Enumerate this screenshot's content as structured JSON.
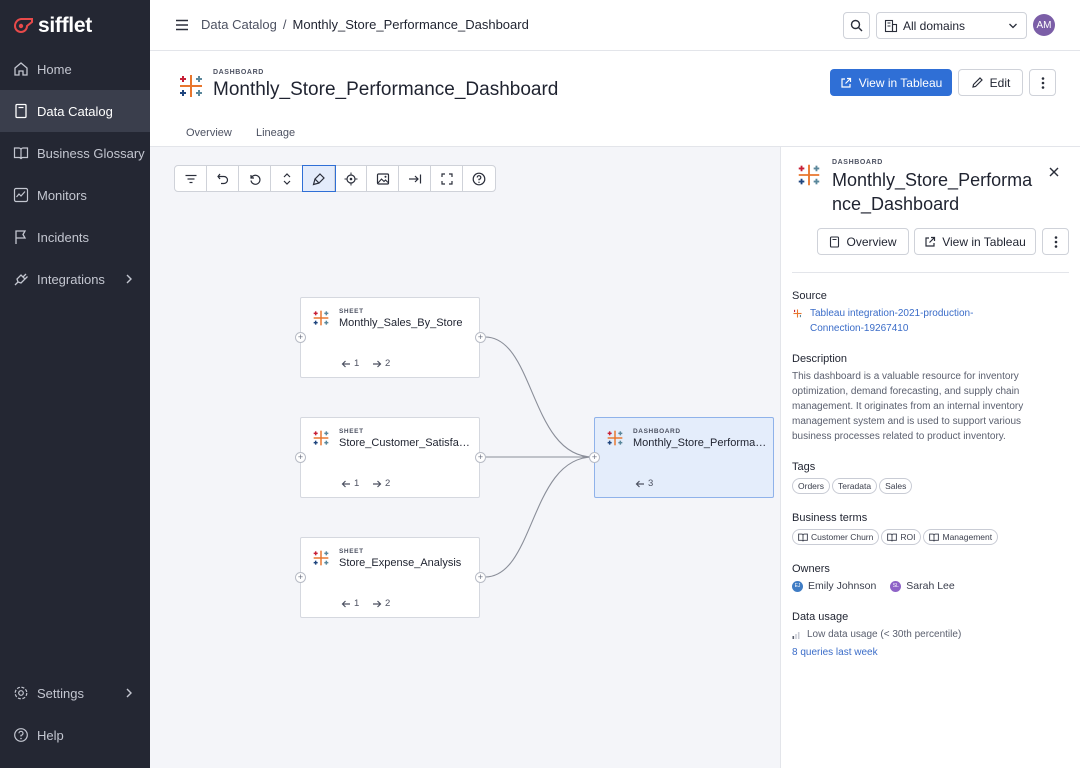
{
  "app": {
    "name": "sifflet"
  },
  "sidebar": {
    "items": [
      {
        "label": "Home",
        "icon": "home-icon"
      },
      {
        "label": "Data Catalog",
        "icon": "book-icon"
      },
      {
        "label": "Business Glossary",
        "icon": "open-book-icon"
      },
      {
        "label": "Monitors",
        "icon": "monitor-chart-icon"
      },
      {
        "label": "Incidents",
        "icon": "flag-icon"
      },
      {
        "label": "Integrations",
        "icon": "plug-icon"
      }
    ],
    "bottom": [
      {
        "label": "Settings",
        "icon": "gear-icon"
      },
      {
        "label": "Help",
        "icon": "help-circle-icon"
      }
    ],
    "active": "Data Catalog"
  },
  "topbar": {
    "breadcrumb": {
      "parent": "Data Catalog",
      "separator": "/",
      "current": "Monthly_Store_Performance_Dashboard"
    },
    "domain": "All domains",
    "avatar": "AM"
  },
  "header": {
    "kind": "DASHBOARD",
    "title": "Monthly_Store_Performance_Dashboard",
    "view_btn": "View in Tableau",
    "edit_btn": "Edit",
    "tabs": [
      "Overview",
      "Lineage"
    ]
  },
  "lineage": {
    "tools": [
      "filter-icon",
      "undo-icon",
      "reset-icon",
      "expand-vertical-icon",
      "brush-icon",
      "focus-icon",
      "image-icon",
      "arrow-to-right-icon",
      "fullscreen-icon",
      "help-icon"
    ],
    "nodes": [
      {
        "kind": "SHEET",
        "name": "Monthly_Sales_By_Store",
        "in": "1",
        "out": "2"
      },
      {
        "kind": "SHEET",
        "name": "Store_Customer_Satisfaction",
        "in": "1",
        "out": "2"
      },
      {
        "kind": "SHEET",
        "name": "Store_Expense_Analysis",
        "in": "1",
        "out": "2"
      },
      {
        "kind": "DASHBOARD",
        "name": "Monthly_Store_Performance_Dashboard",
        "in": "3"
      }
    ]
  },
  "panel": {
    "kind": "DASHBOARD",
    "title": "Monthly_Store_Performance_Dashboard",
    "overview_btn": "Overview",
    "view_btn": "View in Tableau",
    "source_label": "Source",
    "source_line1": "Tableau integration-2021-production-",
    "source_line2": "Connection-19267410",
    "description_label": "Description",
    "description": "This dashboard is a valuable resource for inventory optimization, demand forecasting, and supply chain management. It originates from an internal inventory management system and is used to support various business processes related to product inventory.",
    "tags_label": "Tags",
    "tags": [
      "Orders",
      "Teradata",
      "Sales"
    ],
    "terms_label": "Business terms",
    "terms": [
      "Customer Churn",
      "ROI",
      "Management"
    ],
    "owners_label": "Owners",
    "owners": [
      {
        "initials": "EJ",
        "name": "Emily Johnson",
        "color": "#3f7cc4"
      },
      {
        "initials": "SL",
        "name": "Sarah Lee",
        "color": "#8e63c7"
      }
    ],
    "usage_label": "Data usage",
    "usage_text": "Low data usage (< 30th percentile)",
    "queries_link": "8 queries last week"
  },
  "colors": {
    "sidebar_bg": "#242733",
    "primary": "#2f6fd6",
    "canvas_bg": "#f4f5f9",
    "link": "#3a6cc8"
  }
}
